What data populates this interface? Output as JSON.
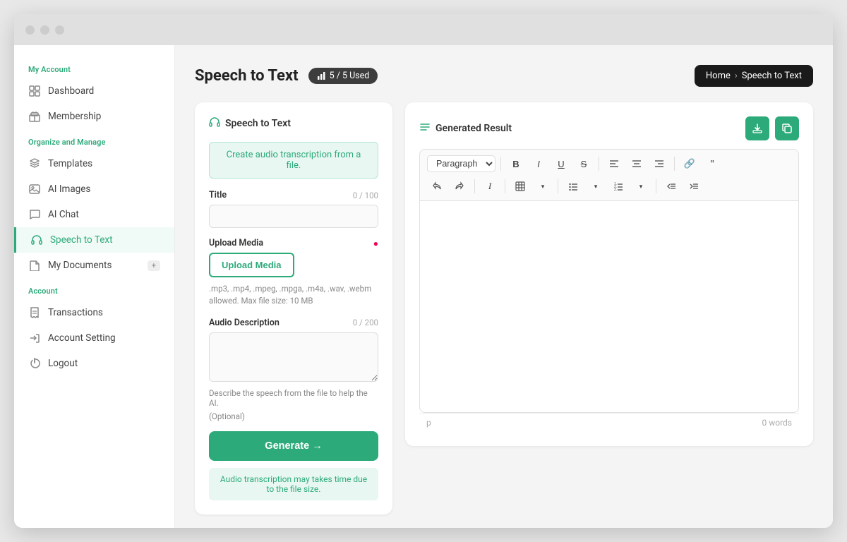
{
  "window": {
    "title": "Speech to Text"
  },
  "sidebar": {
    "myAccount": {
      "label": "My Account",
      "items": [
        {
          "id": "dashboard",
          "label": "Dashboard",
          "icon": "grid-icon"
        },
        {
          "id": "membership",
          "label": "Membership",
          "icon": "gift-icon"
        }
      ]
    },
    "organizeManage": {
      "label": "Organize and Manage",
      "items": [
        {
          "id": "templates",
          "label": "Templates",
          "icon": "layers-icon"
        },
        {
          "id": "ai-images",
          "label": "AI Images",
          "icon": "image-icon"
        },
        {
          "id": "ai-chat",
          "label": "AI Chat",
          "icon": "chat-icon"
        },
        {
          "id": "speech-to-text",
          "label": "Speech to Text",
          "icon": "headphone-icon",
          "active": true
        },
        {
          "id": "my-documents",
          "label": "My Documents",
          "icon": "document-icon",
          "badge": "+"
        }
      ]
    },
    "account": {
      "label": "Account",
      "items": [
        {
          "id": "transactions",
          "label": "Transactions",
          "icon": "receipt-icon"
        },
        {
          "id": "account-setting",
          "label": "Account Setting",
          "icon": "login-icon"
        },
        {
          "id": "logout",
          "label": "Logout",
          "icon": "power-icon"
        }
      ]
    }
  },
  "header": {
    "title": "Speech to Text",
    "usage": "5 / 5 Used",
    "breadcrumb": {
      "home": "Home",
      "separator": "›",
      "current": "Speech to Text"
    }
  },
  "leftCard": {
    "title": "Speech to Text",
    "hint": "Create audio transcription from a file.",
    "titleField": {
      "label": "Title",
      "count": "0 / 100",
      "placeholder": ""
    },
    "uploadMedia": {
      "label": "Upload Media",
      "required": true,
      "btnLabel": "Upload Media",
      "hint": ".mp3, .mp4, .mpeg, .mpga, .m4a, .wav, .webm allowed. Max file size: 10 MB"
    },
    "audioDescription": {
      "label": "Audio Description",
      "count": "0 / 200",
      "hint": "Describe the speech from the file to help the AI.",
      "optionalHint": "(Optional)"
    },
    "generateBtn": "Generate →",
    "generateHint": "Audio transcription may takes time due to the file size."
  },
  "rightCard": {
    "title": "Generated Result",
    "toolbar": {
      "paragraph": "Paragraph",
      "buttons": [
        "B",
        "I",
        "U",
        "S",
        "≡",
        "≡",
        "≡",
        "🔗",
        "❝",
        "↩",
        "↪",
        "𝐼",
        "⊞",
        "≡",
        "≡",
        "≡",
        "≡",
        "⇤",
        "⇥"
      ]
    },
    "footer": {
      "tag": "p",
      "wordCount": "0 words"
    }
  }
}
